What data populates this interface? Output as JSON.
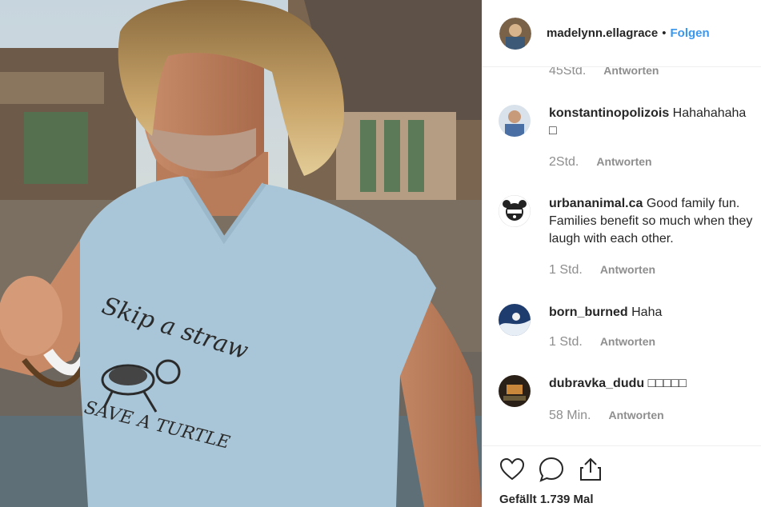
{
  "post": {
    "username": "madelynn.ellagrace",
    "separator": "•",
    "follow_label": "Folgen",
    "likes_text": "Gefällt 1.739 Mal"
  },
  "comments": {
    "reply_label": "Antworten",
    "top_partial": {
      "time": "45Std."
    },
    "items": [
      {
        "user": "konstantinopolizois",
        "text": "Hahahahaha",
        "text2": "□",
        "time": "2Std."
      },
      {
        "user": "urbananimal.ca",
        "text": "Good family fun. Families benefit so much when they laugh with each other.",
        "time": "1 Std."
      },
      {
        "user": "born_burned",
        "text": "Haha",
        "time": "1 Std."
      },
      {
        "user": "dubravka_dudu",
        "text": "□□□□□",
        "time": "58 Min."
      }
    ]
  },
  "photo": {
    "shirt_line1": "Skip a straw",
    "shirt_line2": "SAVE A TURTLE"
  },
  "icons": {
    "like": "heart-icon",
    "comment": "speech-bubble-icon",
    "share": "share-icon"
  },
  "colors": {
    "link_blue": "#3897f0",
    "text": "#262626",
    "muted": "#8e8e8e",
    "shirt": "#a9c6d8"
  }
}
